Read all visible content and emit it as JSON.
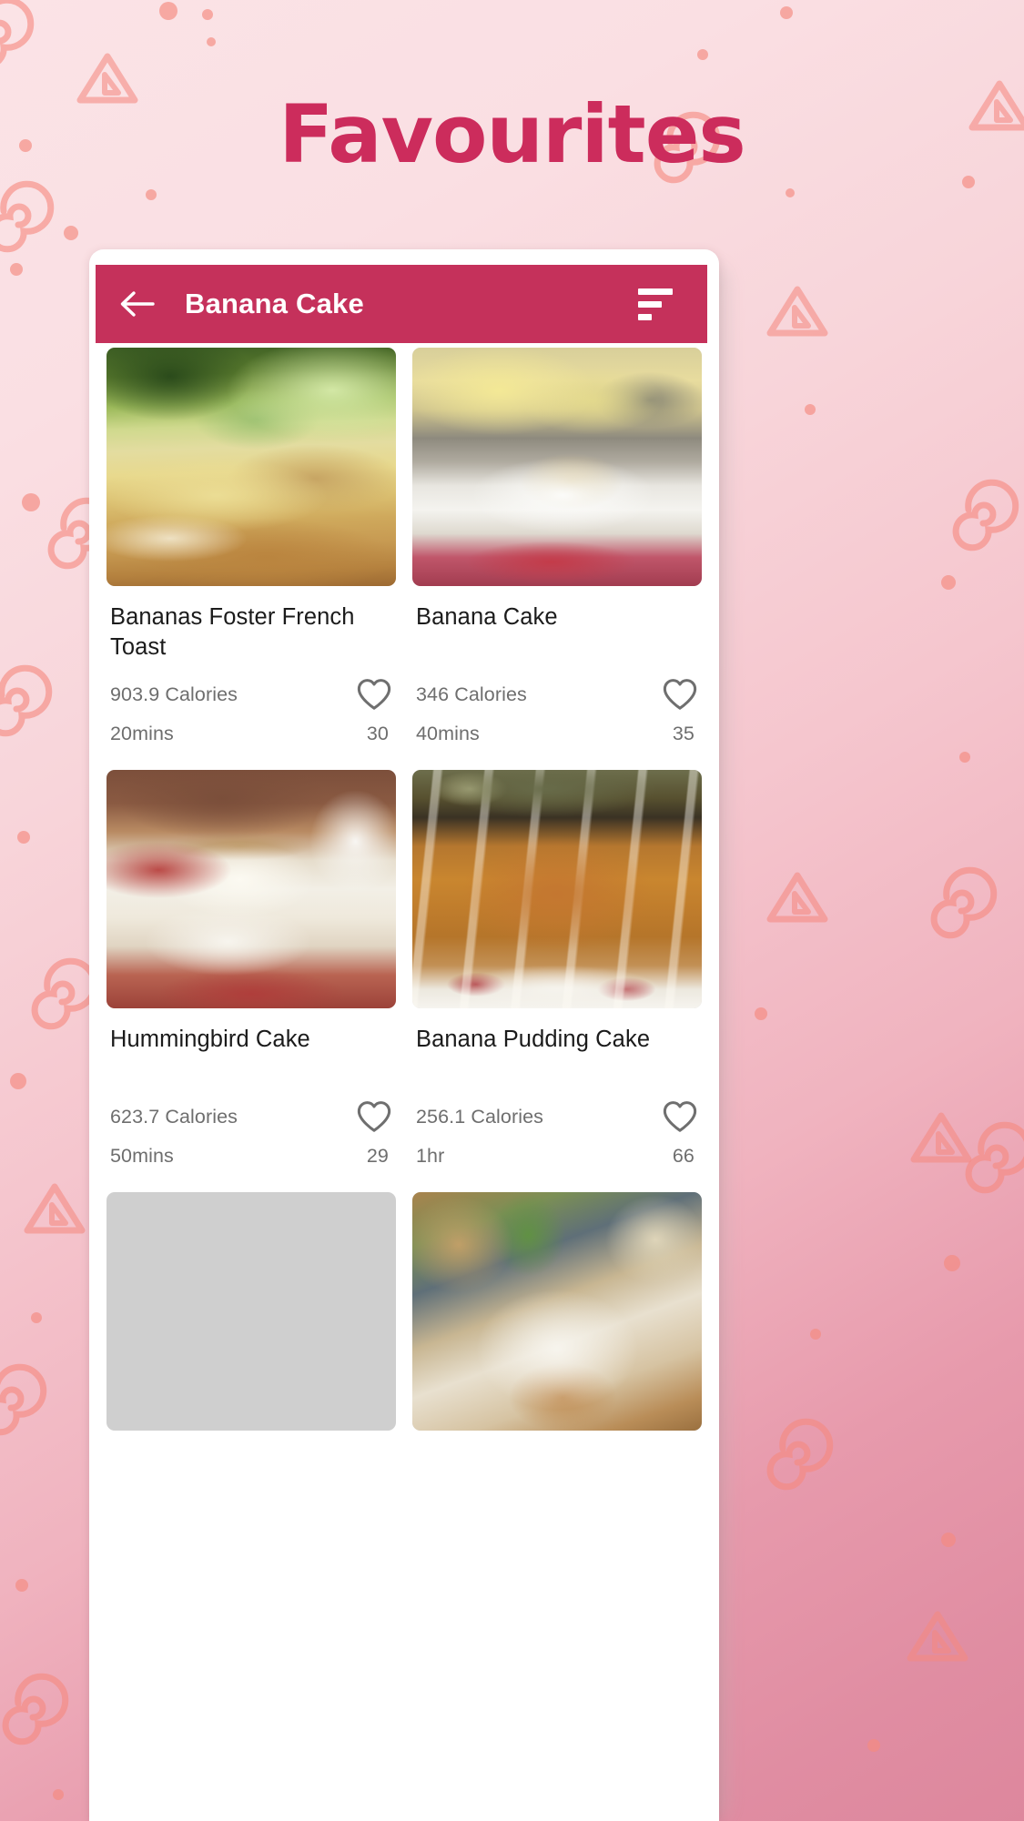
{
  "page": {
    "title": "Favourites",
    "title_color": "#cc2c5c",
    "background_colors": [
      "#fbe3e6",
      "#f5c6ce",
      "#dd879d"
    ],
    "doodle_color": "#f6897f"
  },
  "appbar": {
    "back_icon": "arrow-left-icon",
    "title": "Banana Cake",
    "sort_icon": "sort-lines-icon",
    "background_color": "#c5315b",
    "text_color": "#ffffff"
  },
  "recipes": [
    {
      "name": "Bananas Foster French Toast",
      "calories": "903.9 Calories",
      "time": "20mins",
      "likes": "30",
      "favorite_icon": "heart-outline-icon",
      "photo": "bananas-foster-french-toast-photo"
    },
    {
      "name": "Banana Cake",
      "calories": "346 Calories",
      "time": "40mins",
      "likes": "35",
      "favorite_icon": "heart-outline-icon",
      "photo": "banana-cake-photo"
    },
    {
      "name": "Hummingbird Cake",
      "calories": "623.7 Calories",
      "time": "50mins",
      "likes": "29",
      "favorite_icon": "heart-outline-icon",
      "photo": "hummingbird-cake-photo"
    },
    {
      "name": "Banana Pudding Cake",
      "calories": "256.1 Calories",
      "time": "1hr",
      "likes": "66",
      "favorite_icon": "heart-outline-icon",
      "photo": "banana-pudding-cake-photo"
    },
    {
      "name": "",
      "calories": "",
      "time": "",
      "likes": "",
      "favorite_icon": "heart-outline-icon",
      "photo": "banana-bread-pan-photo"
    },
    {
      "name": "",
      "calories": "",
      "time": "",
      "likes": "",
      "favorite_icon": "heart-outline-icon",
      "photo": "powdered-sugar-cake-photo"
    }
  ]
}
